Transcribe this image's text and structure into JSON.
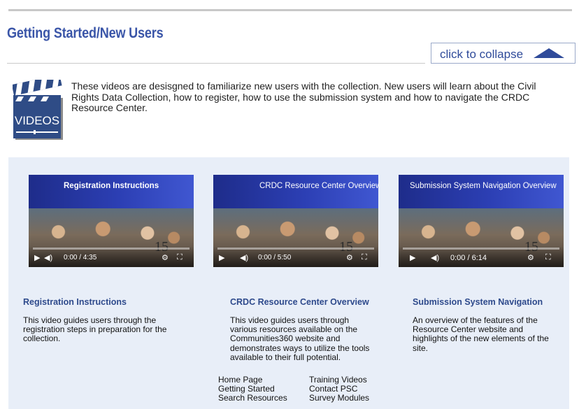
{
  "section": {
    "title": "Getting Started/New Users",
    "collapse_label": "click to collapse"
  },
  "logo_text": "VIDEOS",
  "intro": "These videos are desisgned to familiarize new users with the collection. New users will learn about the Civil Rights Data Collection, how to register, how to use the submission system and how to navigate the CRDC Resource Center.",
  "videos": [
    {
      "thumb_title": "Registration Instructions",
      "time": "0:00 / 4:35",
      "label": "Registration Instructions",
      "description": "This video guides users through the registration steps in preparation for the collection."
    },
    {
      "thumb_title": "CRDC Resource Center Overview",
      "time": "0:00 / 5:50",
      "label": "CRDC Resource Center Overview",
      "description": "This video guides users through various resources available on the Communities360 website and demonstrates ways to utilize the tools available to their full potential."
    },
    {
      "thumb_title": "Submission System Navigation Overview",
      "time": "0:00 / 6:14",
      "label": "Submission System Navigation",
      "description": "An overview of the features of the Resource Center website and highlights of the new elements of the site."
    }
  ],
  "footer_links": {
    "col1": [
      "Home Page",
      "Getting Started",
      "Search Resources"
    ],
    "col2": [
      "Training Videos",
      "Contact PSC",
      "Survey Modules"
    ]
  },
  "colors": {
    "title": "#3a55a8",
    "panel": "#e8eef8",
    "label": "#2e4a8c"
  }
}
